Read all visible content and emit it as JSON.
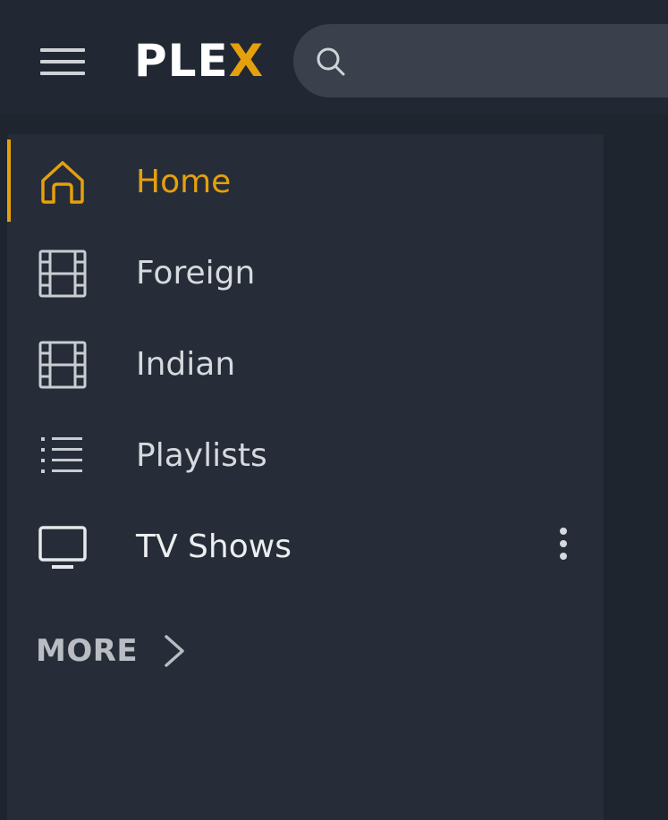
{
  "app": {
    "logo_text": "PLE",
    "logo_accent": "X",
    "accent_color": "#e5a00d"
  },
  "header": {
    "menu_icon": "hamburger-icon",
    "search_icon": "search-icon",
    "search_value": ""
  },
  "sidebar": {
    "items": [
      {
        "label": "Home",
        "icon": "home-icon",
        "active": true
      },
      {
        "label": "Foreign",
        "icon": "film-icon",
        "active": false
      },
      {
        "label": "Indian",
        "icon": "film-icon",
        "active": false
      },
      {
        "label": "Playlists",
        "icon": "list-icon",
        "active": false
      },
      {
        "label": "TV Shows",
        "icon": "tv-icon",
        "active": false,
        "has_menu": true
      }
    ],
    "more_label": "MORE",
    "more_icon": "chevron-right-icon",
    "item_menu_icon": "vertical-dots-icon"
  }
}
